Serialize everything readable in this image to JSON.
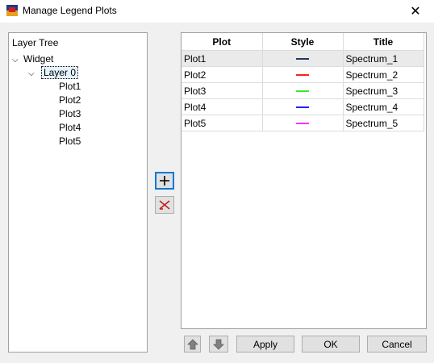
{
  "window": {
    "title": "Manage Legend Plots",
    "close_glyph": "✕"
  },
  "tree": {
    "header": "Layer Tree",
    "widget_label": "Widget",
    "layer_label": "Layer 0",
    "plots": [
      "Plot1",
      "Plot2",
      "Plot3",
      "Plot4",
      "Plot5"
    ]
  },
  "table": {
    "columns": [
      "Plot",
      "Style",
      "Title"
    ],
    "rows": [
      {
        "plot": "Plot1",
        "style_color": "#1f3a5a",
        "title": "Spectrum_1"
      },
      {
        "plot": "Plot2",
        "style_color": "#ff2020",
        "title": "Spectrum_2"
      },
      {
        "plot": "Plot3",
        "style_color": "#33ee33",
        "title": "Spectrum_3"
      },
      {
        "plot": "Plot4",
        "style_color": "#2222ff",
        "title": "Spectrum_4"
      },
      {
        "plot": "Plot5",
        "style_color": "#ff33ff",
        "title": "Spectrum_5"
      }
    ]
  },
  "buttons": {
    "apply": "Apply",
    "ok": "OK",
    "cancel": "Cancel"
  },
  "icons": {
    "add": "plus-icon",
    "remove": "remove-icon",
    "up": "move-up-icon",
    "down": "move-down-icon"
  }
}
